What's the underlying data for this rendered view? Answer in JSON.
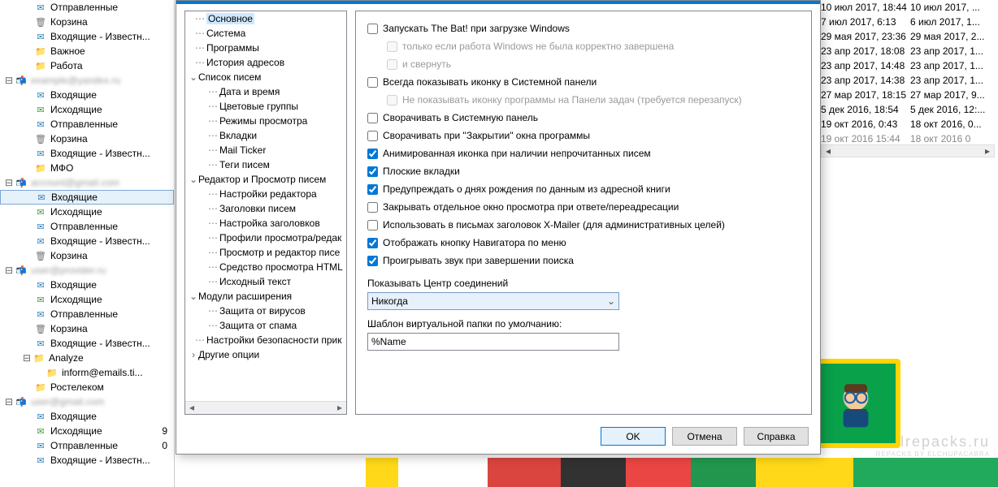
{
  "folders": {
    "acc1": {
      "items": [
        {
          "icon": "inbox",
          "label": "Отправленные"
        },
        {
          "icon": "trash",
          "label": "Корзина"
        },
        {
          "icon": "inbox",
          "label": "Входящие - Известн..."
        },
        {
          "icon": "folder",
          "label": "Важное"
        },
        {
          "icon": "folder",
          "label": "Работа"
        }
      ]
    },
    "acc2": {
      "items": [
        {
          "icon": "inbox",
          "label": "Входящие"
        },
        {
          "icon": "outbox",
          "label": "Исходящие"
        },
        {
          "icon": "inbox",
          "label": "Отправленные"
        },
        {
          "icon": "trash",
          "label": "Корзина"
        },
        {
          "icon": "inbox",
          "label": "Входящие - Известн..."
        },
        {
          "icon": "folder",
          "label": "МФО"
        }
      ]
    },
    "acc3": {
      "items": [
        {
          "icon": "inbox",
          "label": "Входящие",
          "selected": true
        },
        {
          "icon": "outbox",
          "label": "Исходящие"
        },
        {
          "icon": "inbox",
          "label": "Отправленные"
        },
        {
          "icon": "inbox",
          "label": "Входящие - Известн..."
        },
        {
          "icon": "trash",
          "label": "Корзина"
        }
      ]
    },
    "acc4": {
      "items": [
        {
          "icon": "inbox",
          "label": "Входящие"
        },
        {
          "icon": "outbox",
          "label": "Исходящие"
        },
        {
          "icon": "inbox",
          "label": "Отправленные"
        },
        {
          "icon": "trash",
          "label": "Корзина"
        },
        {
          "icon": "inbox",
          "label": "Входящие - Известн..."
        },
        {
          "icon": "folder",
          "label": "Analyze"
        },
        {
          "icon": "folder",
          "label": "inform@emails.ti...",
          "sub": true
        },
        {
          "icon": "folder",
          "label": "Ростелеком"
        }
      ]
    },
    "acc5": {
      "items": [
        {
          "icon": "inbox",
          "label": "Входящие"
        },
        {
          "icon": "outbox",
          "label": "Исходящие",
          "count": "9"
        },
        {
          "icon": "inbox",
          "label": "Отправленные",
          "count": "0"
        },
        {
          "icon": "inbox",
          "label": "Входящие - Известн..."
        }
      ]
    }
  },
  "messages": {
    "rows": [
      {
        "c1": "10 июл 2017, 18:44",
        "c2": "10 июл 2017, ..."
      },
      {
        "c1": "7 июл 2017, 6:13",
        "c2": "6 июл 2017, 1..."
      },
      {
        "c1": "29 мая 2017, 23:36",
        "c2": "29 мая 2017, 2..."
      },
      {
        "c1": "23 апр 2017, 18:08",
        "c2": "23 апр 2017, 1..."
      },
      {
        "c1": "23 апр 2017, 14:48",
        "c2": "23 апр 2017, 1..."
      },
      {
        "c1": "23 апр 2017, 14:38",
        "c2": "23 апр 2017, 1..."
      },
      {
        "c1": "27 мар 2017, 18:15",
        "c2": "27 мар 2017, 9..."
      },
      {
        "c1": "5 дек 2016, 18:54",
        "c2": "5 дек 2016, 12:..."
      },
      {
        "c1": "19 окт 2016, 0:43",
        "c2": "18 окт 2016, 0..."
      },
      {
        "c1": "19 окт 2016  15:44",
        "c2": "18 окт 2016  0"
      }
    ]
  },
  "dialog": {
    "tree": [
      {
        "lvl": "lvl0",
        "exp": "",
        "label": "Основное",
        "sel": true
      },
      {
        "lvl": "lvl0",
        "exp": "",
        "label": "Система"
      },
      {
        "lvl": "lvl0",
        "exp": "",
        "label": "Программы"
      },
      {
        "lvl": "lvl0",
        "exp": "",
        "label": "История адресов"
      },
      {
        "lvl": "grp",
        "exp": "⌄",
        "label": "Список писем"
      },
      {
        "lvl": "lvl1",
        "label": "Дата и время"
      },
      {
        "lvl": "lvl1",
        "label": "Цветовые группы"
      },
      {
        "lvl": "lvl1",
        "label": "Режимы просмотра"
      },
      {
        "lvl": "lvl1",
        "label": "Вкладки"
      },
      {
        "lvl": "lvl1",
        "label": "Mail Ticker"
      },
      {
        "lvl": "lvl1",
        "label": "Теги писем"
      },
      {
        "lvl": "grp",
        "exp": "⌄",
        "label": "Редактор и Просмотр писем"
      },
      {
        "lvl": "lvl1",
        "label": "Настройки редактора"
      },
      {
        "lvl": "lvl1",
        "label": "Заголовки писем"
      },
      {
        "lvl": "lvl1",
        "label": "Настройка заголовков"
      },
      {
        "lvl": "lvl1",
        "label": "Профили просмотра/редак"
      },
      {
        "lvl": "lvl1",
        "label": "Просмотр и редактор писе"
      },
      {
        "lvl": "lvl1",
        "label": "Средство просмотра HTML"
      },
      {
        "lvl": "lvl1",
        "label": "Исходный текст"
      },
      {
        "lvl": "grp",
        "exp": "⌄",
        "label": "Модули расширения"
      },
      {
        "lvl": "lvl1",
        "label": "Защита от вирусов"
      },
      {
        "lvl": "lvl1",
        "label": "Защита от спама"
      },
      {
        "lvl": "lvl0",
        "label": "Настройки безопасности прик"
      },
      {
        "lvl": "grp",
        "exp": "›",
        "label": "Другие опции"
      }
    ],
    "opts": {
      "c1": "Запускать The Bat! при загрузке Windows",
      "c1a": "только если работа Windows не была корректно завершена",
      "c1b": "и свернуть",
      "c2": "Всегда показывать иконку в Системной панели",
      "c2a": "Не показывать иконку программы на Панели задач (требуется перезапуск)",
      "c3": "Сворачивать в Системную панель",
      "c4": "Сворачивать при \"Закрытии\" окна программы",
      "c5": "Анимированная иконка при наличии непрочитанных писем",
      "c6": "Плоские вкладки",
      "c7": "Предупреждать о днях рождения по данным из адресной книги",
      "c8": "Закрывать отдельное окно просмотра при ответе/переадресации",
      "c9": "Использовать в письмах заголовок X-Mailer (для административных целей)",
      "c10": "Отображать кнопку Навигатора по меню",
      "c11": "Проигрывать звук при завершении поиска",
      "combo_label": "Показывать Центр соединений",
      "combo_value": "Никогда",
      "tmpl_label": "Шаблон виртуальной папки по умолчанию:",
      "tmpl_value": "%Name"
    },
    "buttons": {
      "ok": "OK",
      "cancel": "Отмена",
      "help": "Справка"
    }
  },
  "watermark": {
    "l1": "lrepacks.ru",
    "l2": "REPACKS BY ELCHUPACABRA"
  }
}
